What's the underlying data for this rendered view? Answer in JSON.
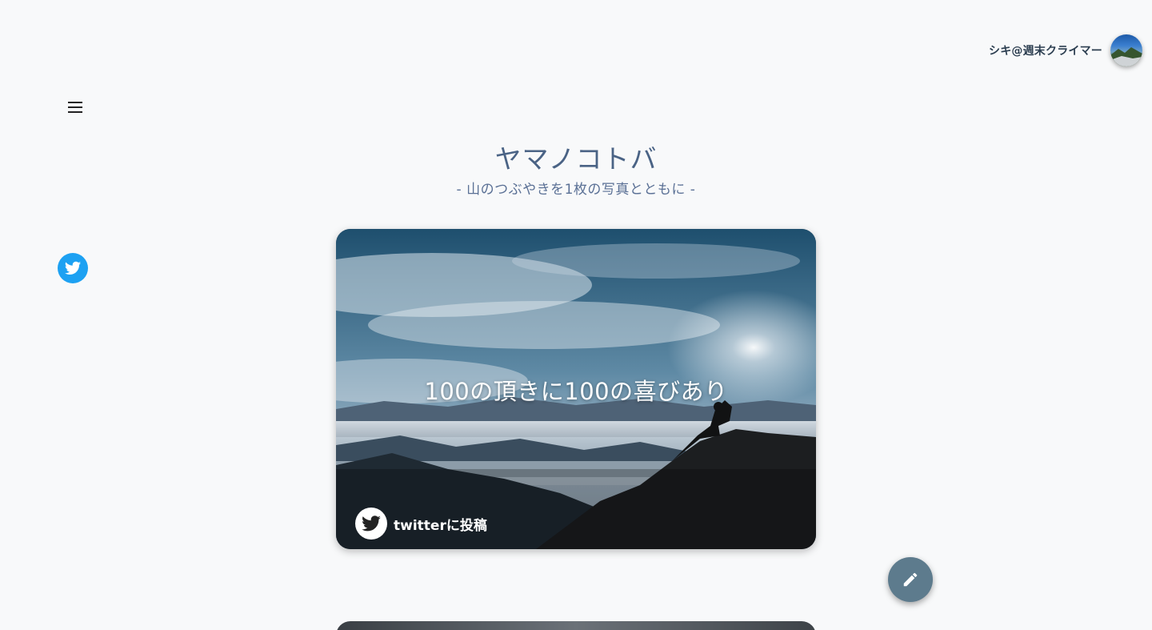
{
  "user": {
    "name": "シキ@週末クライマー"
  },
  "site": {
    "title": "ヤマノコトバ",
    "subtitle": "-  山のつぶやきを1枚の写真とともに  -"
  },
  "card": {
    "quote": "100の頂きに100の喜びあり",
    "post_label": "twitterに投稿"
  },
  "colors": {
    "twitter": "#1da1f2",
    "fab": "#5d7b8d",
    "title": "#4a6385"
  },
  "icons": {
    "menu": "hamburger-menu-icon",
    "twitter": "twitter-bird-icon",
    "edit": "pencil-icon"
  }
}
